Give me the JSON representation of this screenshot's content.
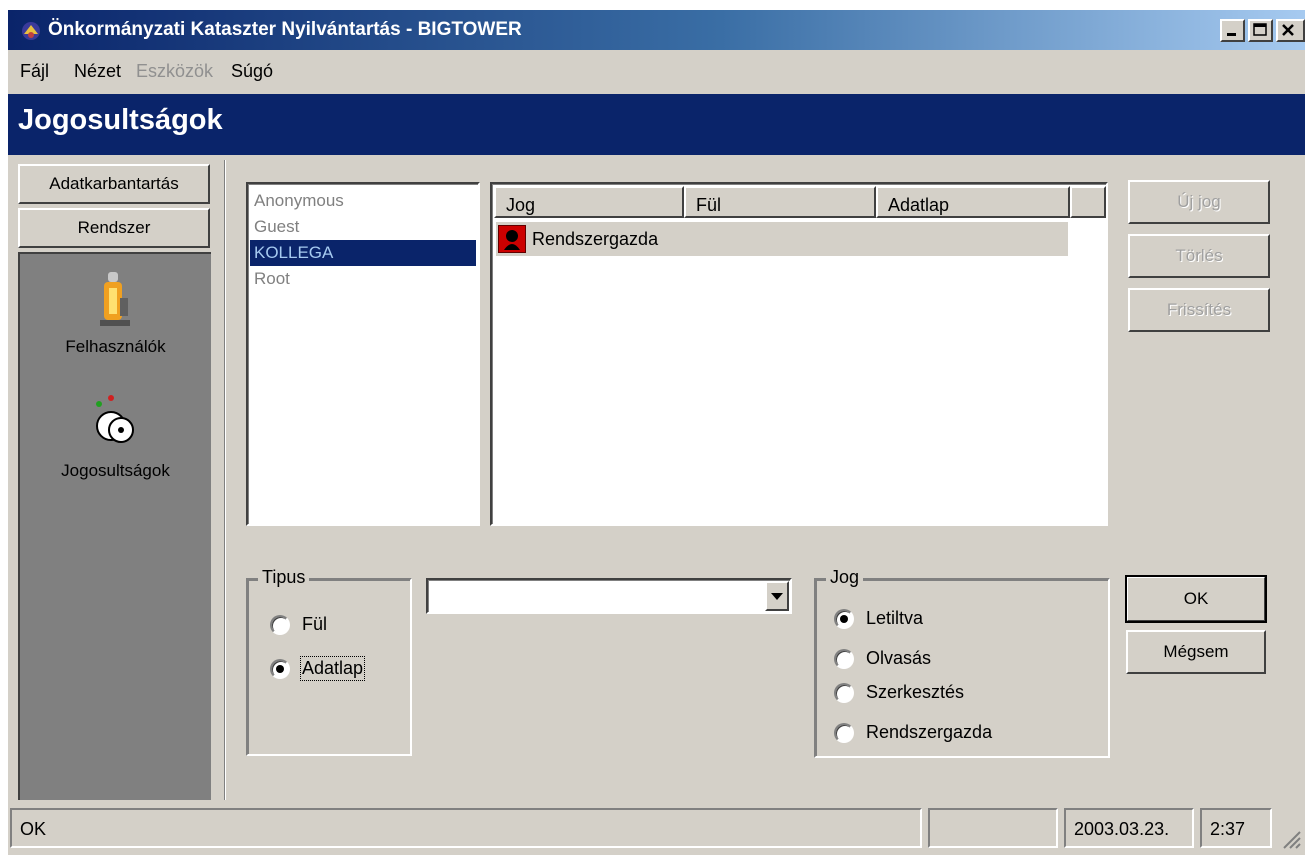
{
  "window": {
    "title": "Önkormányzati Kataszter Nyilvántartás - BIGTOWER",
    "controls": [
      "minimize-icon",
      "maximize-icon",
      "close-icon"
    ]
  },
  "menu": {
    "items": [
      {
        "label": "Fájl",
        "enabled": true
      },
      {
        "label": "Nézet",
        "enabled": true
      },
      {
        "label": "Eszközök",
        "enabled": false
      },
      {
        "label": "Súgó",
        "enabled": true
      }
    ]
  },
  "header": {
    "title": "Jogosultságok"
  },
  "sidebar": {
    "groups": [
      "Adatkarbantartás",
      "Rendszer"
    ],
    "items": [
      {
        "label": "Felhasználók",
        "icon": "user-icon"
      },
      {
        "label": "Jogosultságok",
        "icon": "keys-icon"
      }
    ]
  },
  "users": {
    "items": [
      "Anonymous",
      "Guest",
      "KOLLEGA",
      "Root"
    ],
    "selected": "KOLLEGA"
  },
  "grid": {
    "columns": [
      "Jog",
      "Fül",
      "Adatlap"
    ],
    "rows": [
      {
        "jog": "Rendszergazda",
        "icon": "admin-icon"
      }
    ]
  },
  "actions": {
    "new_label": "Új jog",
    "delete_label": "Törlés",
    "refresh_label": "Frissítés"
  },
  "tipus": {
    "title": "Tipus",
    "options": [
      "Fül",
      "Adatlap"
    ],
    "selected": "Adatlap"
  },
  "combo": {
    "value": ""
  },
  "jog": {
    "title": "Jog",
    "options": [
      "Letiltva",
      "Olvasás",
      "Szerkesztés",
      "Rendszergazda"
    ],
    "selected": "Letiltva"
  },
  "dialog": {
    "ok_label": "OK",
    "cancel_label": "Mégsem"
  },
  "status": {
    "message": "OK",
    "date": "2003.03.23.",
    "time": "2:37"
  },
  "colors": {
    "title_bar_start": "#0a246a",
    "title_bar_end": "#a6caf0",
    "header_band": "#0a246a",
    "face": "#d4d0c8",
    "selection": "#0a246a",
    "admin_icon": "#cc0000"
  }
}
